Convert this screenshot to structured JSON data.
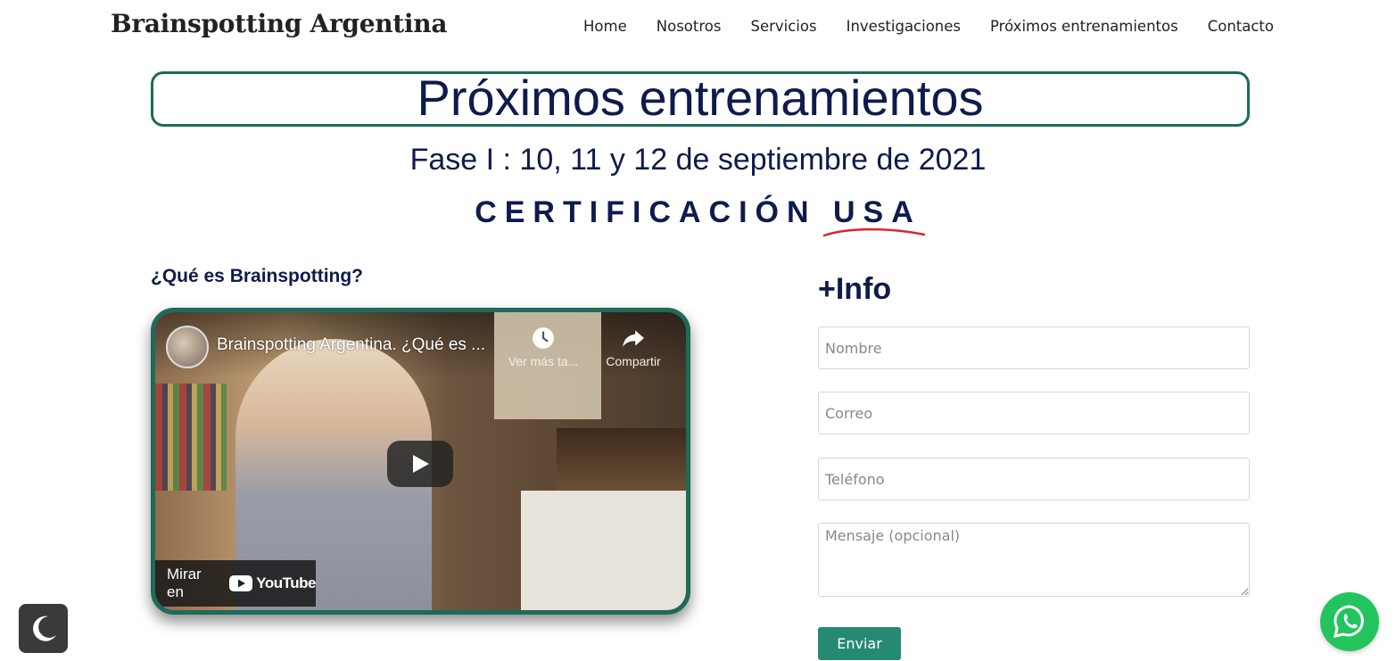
{
  "header": {
    "logo": "Brainspotting Argentina",
    "nav": [
      "Home",
      "Nosotros",
      "Servicios",
      "Investigaciones",
      "Próximos entrenamientos",
      "Contacto"
    ]
  },
  "hero": {
    "title": "Próximos entrenamientos",
    "phase": "Fase I : 10, 11 y 12 de septiembre de 2021",
    "cert_prefix": "CERTIFICACIÓN",
    "cert_highlight": "USA",
    "underline_color": "#d9262b"
  },
  "video_section": {
    "heading": "¿Qué es Brainspotting?",
    "video": {
      "title": "Brainspotting Argentina. ¿Qué es ...",
      "watch_later": "Ver más ta...",
      "share": "Compartir",
      "watch_on": "Mirar en",
      "youtube": "YouTube"
    }
  },
  "form": {
    "heading": "+Info",
    "name_placeholder": "Nombre",
    "email_placeholder": "Correo",
    "phone_placeholder": "Teléfono",
    "message_placeholder": "Mensaje (opcional)",
    "submit_label": "Enviar"
  },
  "colors": {
    "accent": "#1d6b5a",
    "button": "#268a73",
    "text_dark": "#0f1b4c",
    "whatsapp": "#23c45e"
  }
}
